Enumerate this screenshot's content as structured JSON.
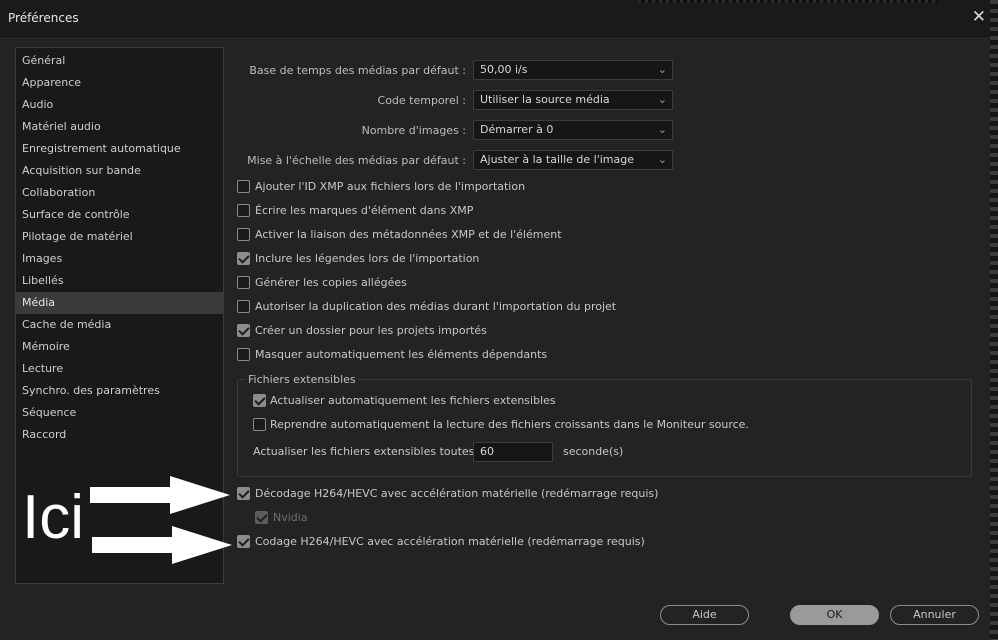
{
  "window": {
    "title": "Préférences"
  },
  "sidebar": {
    "items": [
      {
        "label": "Général"
      },
      {
        "label": "Apparence"
      },
      {
        "label": "Audio"
      },
      {
        "label": "Matériel audio"
      },
      {
        "label": "Enregistrement automatique"
      },
      {
        "label": "Acquisition sur bande"
      },
      {
        "label": "Collaboration"
      },
      {
        "label": "Surface de contrôle"
      },
      {
        "label": "Pilotage de matériel"
      },
      {
        "label": "Images"
      },
      {
        "label": "Libellés"
      },
      {
        "label": "Média"
      },
      {
        "label": "Cache de média"
      },
      {
        "label": "Mémoire"
      },
      {
        "label": "Lecture"
      },
      {
        "label": "Synchro. des paramètres"
      },
      {
        "label": "Séquence"
      },
      {
        "label": "Raccord"
      }
    ],
    "active": "Média"
  },
  "settings": {
    "rows": [
      {
        "label": "Base de temps des médias par défaut :",
        "value": "50,00  i/s"
      },
      {
        "label": "Code temporel :",
        "value": "Utiliser la source média"
      },
      {
        "label": "Nombre d'images :",
        "value": "Démarrer à 0"
      },
      {
        "label": "Mise à l'échelle des médias par défaut :",
        "value": "Ajuster à la taille de l'image"
      }
    ],
    "checkboxes": [
      {
        "label": "Ajouter l'ID XMP aux fichiers lors de l'importation",
        "checked": false
      },
      {
        "label": "Écrire les marques d'élément dans XMP",
        "checked": false
      },
      {
        "label": "Activer la liaison des métadonnées XMP et de l'élément",
        "checked": false
      },
      {
        "label": "Inclure les légendes lors de l'importation",
        "checked": true
      },
      {
        "label": "Générer les copies allégées",
        "checked": false
      },
      {
        "label": "Autoriser la duplication des médias durant l'importation du projet",
        "checked": false
      },
      {
        "label": "Créer un dossier pour les projets importés",
        "checked": true
      },
      {
        "label": "Masquer automatiquement les éléments dépendants",
        "checked": false
      }
    ],
    "growing_files": {
      "title": "Fichiers extensibles",
      "auto_refresh": {
        "label": "Actualiser automatiquement les fichiers extensibles",
        "checked": true
      },
      "resume_playback": {
        "label": "Reprendre automatiquement la lecture des fichiers croissants dans le Moniteur source.",
        "checked": false
      },
      "refresh_label": "Actualiser les fichiers extensibles toutes les",
      "refresh_value": "60",
      "refresh_unit": "seconde(s)"
    },
    "hw_decoding": {
      "label": "Décodage H264/HEVC avec accélération matérielle (redémarrage requis)",
      "checked": true
    },
    "nvidia": {
      "label": "Nvidia",
      "checked": true,
      "disabled": true
    },
    "hw_encoding": {
      "label": "Codage H264/HEVC avec accélération matérielle (redémarrage requis)",
      "checked": true
    }
  },
  "annotation": {
    "text": "Ici",
    "color": "#ffffff"
  },
  "buttons": {
    "help": "Aide",
    "ok": "OK",
    "cancel": "Annuler"
  },
  "icons": {
    "close": "close-icon",
    "chevron": "chevron-down-icon",
    "arrow": "arrow-right-icon"
  }
}
